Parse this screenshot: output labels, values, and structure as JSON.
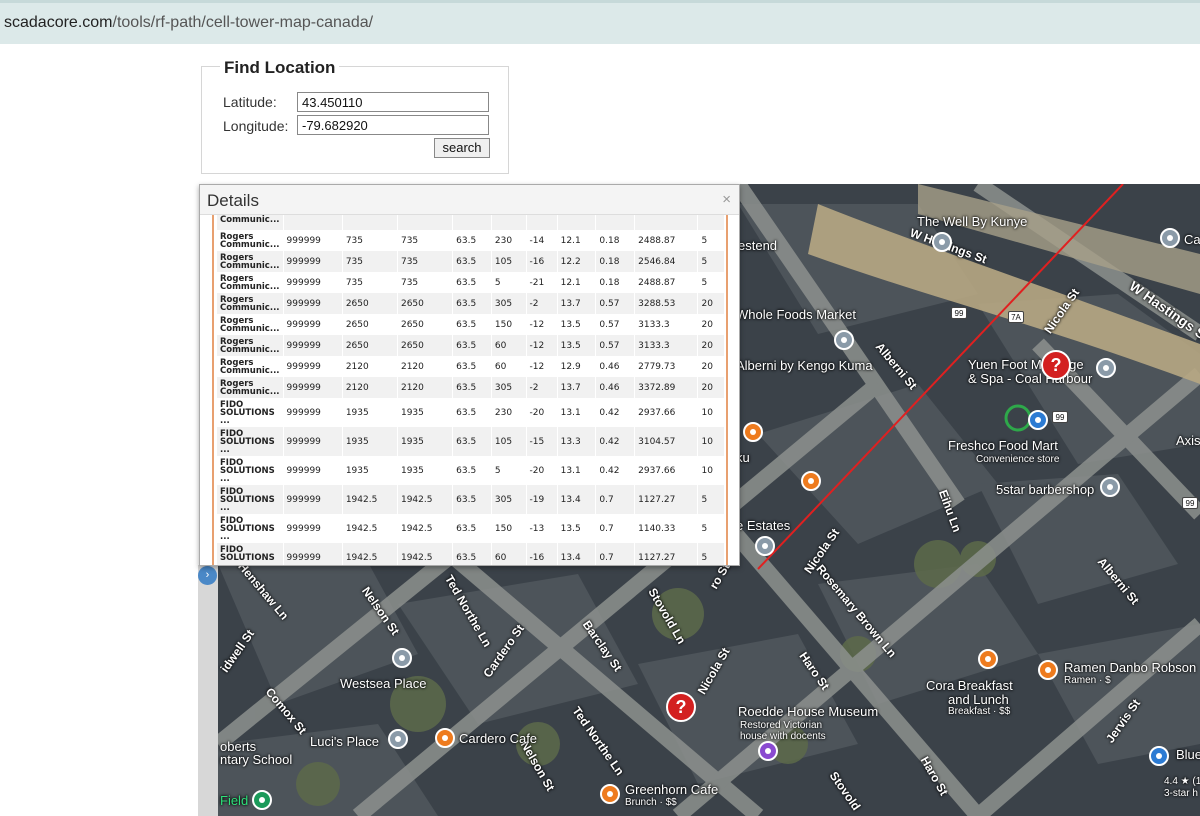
{
  "browser": {
    "url_host": "scadacore.com",
    "url_path": "/tools/rf-path/cell-tower-map-canada/"
  },
  "find_location": {
    "title": "Find Location",
    "latitude_label": "Latitude:",
    "latitude_value": "43.450110",
    "longitude_label": "Longitude:",
    "longitude_value": "-79.682920",
    "search_label": "search"
  },
  "details": {
    "title": "Details",
    "close": "×",
    "partial_first_row": "Communic...",
    "rows": [
      {
        "name": [
          "Rogers",
          "Communic..."
        ],
        "c1": "999999",
        "c2": "735",
        "c3": "735",
        "c4": "63.5",
        "c5": "230",
        "c6": "-14",
        "c7": "12.1",
        "c8": "0.18",
        "c9": "2488.87",
        "c10": "5"
      },
      {
        "name": [
          "Rogers",
          "Communic..."
        ],
        "c1": "999999",
        "c2": "735",
        "c3": "735",
        "c4": "63.5",
        "c5": "105",
        "c6": "-16",
        "c7": "12.2",
        "c8": "0.18",
        "c9": "2546.84",
        "c10": "5"
      },
      {
        "name": [
          "Rogers",
          "Communic..."
        ],
        "c1": "999999",
        "c2": "735",
        "c3": "735",
        "c4": "63.5",
        "c5": "5",
        "c6": "-21",
        "c7": "12.1",
        "c8": "0.18",
        "c9": "2488.87",
        "c10": "5"
      },
      {
        "name": [
          "Rogers",
          "Communic..."
        ],
        "c1": "999999",
        "c2": "2650",
        "c3": "2650",
        "c4": "63.5",
        "c5": "305",
        "c6": "-2",
        "c7": "13.7",
        "c8": "0.57",
        "c9": "3288.53",
        "c10": "20"
      },
      {
        "name": [
          "Rogers",
          "Communic..."
        ],
        "c1": "999999",
        "c2": "2650",
        "c3": "2650",
        "c4": "63.5",
        "c5": "150",
        "c6": "-12",
        "c7": "13.5",
        "c8": "0.57",
        "c9": "3133.3",
        "c10": "20"
      },
      {
        "name": [
          "Rogers",
          "Communic..."
        ],
        "c1": "999999",
        "c2": "2650",
        "c3": "2650",
        "c4": "63.5",
        "c5": "60",
        "c6": "-12",
        "c7": "13.5",
        "c8": "0.57",
        "c9": "3133.3",
        "c10": "20"
      },
      {
        "name": [
          "Rogers",
          "Communic..."
        ],
        "c1": "999999",
        "c2": "2120",
        "c3": "2120",
        "c4": "63.5",
        "c5": "60",
        "c6": "-12",
        "c7": "12.9",
        "c8": "0.46",
        "c9": "2779.73",
        "c10": "20"
      },
      {
        "name": [
          "Rogers",
          "Communic..."
        ],
        "c1": "999999",
        "c2": "2120",
        "c3": "2120",
        "c4": "63.5",
        "c5": "305",
        "c6": "-2",
        "c7": "13.7",
        "c8": "0.46",
        "c9": "3372.89",
        "c10": "20"
      },
      {
        "name": [
          "FIDO",
          "SOLUTIONS",
          "..."
        ],
        "c1": "999999",
        "c2": "1935",
        "c3": "1935",
        "c4": "63.5",
        "c5": "230",
        "c6": "-20",
        "c7": "13.1",
        "c8": "0.42",
        "c9": "2937.66",
        "c10": "10"
      },
      {
        "name": [
          "FIDO",
          "SOLUTIONS",
          "..."
        ],
        "c1": "999999",
        "c2": "1935",
        "c3": "1935",
        "c4": "63.5",
        "c5": "105",
        "c6": "-15",
        "c7": "13.3",
        "c8": "0.42",
        "c9": "3104.57",
        "c10": "10"
      },
      {
        "name": [
          "FIDO",
          "SOLUTIONS",
          "..."
        ],
        "c1": "999999",
        "c2": "1935",
        "c3": "1935",
        "c4": "63.5",
        "c5": "5",
        "c6": "-20",
        "c7": "13.1",
        "c8": "0.42",
        "c9": "2937.66",
        "c10": "10"
      },
      {
        "name": [
          "FIDO",
          "SOLUTIONS",
          "..."
        ],
        "c1": "999999",
        "c2": "1942.5",
        "c3": "1942.5",
        "c4": "63.5",
        "c5": "305",
        "c6": "-19",
        "c7": "13.4",
        "c8": "0.7",
        "c9": "1127.27",
        "c10": "5"
      },
      {
        "name": [
          "FIDO",
          "SOLUTIONS",
          "..."
        ],
        "c1": "999999",
        "c2": "1942.5",
        "c3": "1942.5",
        "c4": "63.5",
        "c5": "150",
        "c6": "-13",
        "c7": "13.5",
        "c8": "0.7",
        "c9": "1140.33",
        "c10": "5"
      },
      {
        "name": [
          "FIDO",
          "SOLUTIONS",
          "..."
        ],
        "c1": "999999",
        "c2": "1942.5",
        "c3": "1942.5",
        "c4": "63.5",
        "c5": "60",
        "c6": "-16",
        "c7": "13.4",
        "c8": "0.7",
        "c9": "1127.27",
        "c10": "5"
      }
    ]
  },
  "map": {
    "expand": "›",
    "places": {
      "the_well": "The Well By Kunye",
      "whole_foods": "Whole Foods Market",
      "alberni_kengo": "Alberni by Kengo Kuma",
      "yuen_foot": "Yuen Foot Massage",
      "spa_coal": "& Spa - Coal Harbour",
      "freshco": "Freshco Food Mart",
      "convenience": "Convenience store",
      "barbershop": "5star barbershop",
      "estates": "e Estates",
      "estend": "estend",
      "ku": "ku",
      "axis": "Axis",
      "ca": "Ca",
      "westsea": "Westsea Place",
      "lucis": "Luci's Place",
      "cardero_cafe": "Cardero Cafe",
      "roedde": "Roedde House Museum",
      "roedde_sub1": "Restored Victorian",
      "roedde_sub2": "house with docents",
      "cora": "Cora Breakfast",
      "cora2": "and Lunch",
      "cora_sub": "Breakfast · $$",
      "ramen": "Ramen Danbo Robson",
      "ramen_sub": "Ramen · $",
      "greenhorn": "Greenhorn Cafe",
      "greenhorn_sub": "Brunch · $$",
      "roberts1": "oberts",
      "roberts2": "ntary School",
      "field": "Field",
      "blue_h": "Blue H",
      "rating": "4.4 ★ (1",
      "three_star": "3-star h"
    },
    "streets": {
      "w_hastings": "W Hastings St",
      "w_hastings2": "W Hastings S",
      "nicola1": "Nicola St",
      "alberni1": "Alberni St",
      "alberni2": "Alberni St",
      "eihu": "Eihu Ln",
      "nicola2": "Nicola St",
      "rosemary": "Rosemary Brown Ln",
      "henshaw": "Henshaw Ln",
      "nelson1": "Nelson St",
      "ted1": "Ted Northe Ln",
      "cardero": "Cardero St",
      "barclay": "Barclay St",
      "stovold1": "Stovold Ln",
      "nicola3": "Nicola St",
      "ro_st": "ro St",
      "haro1": "Haro St",
      "comox": "Comox St",
      "idwell": "idwell St",
      "nelson2": "Nelson St",
      "ted2": "Ted Northe Ln",
      "stovold2": "Stovold",
      "haro2": "Haro St",
      "jervis": "Jervis St",
      "shield_99a": "99",
      "shield_7a": "7A",
      "shield_99b": "99",
      "shield_99c": "99",
      "tower_glyph": "?"
    }
  }
}
